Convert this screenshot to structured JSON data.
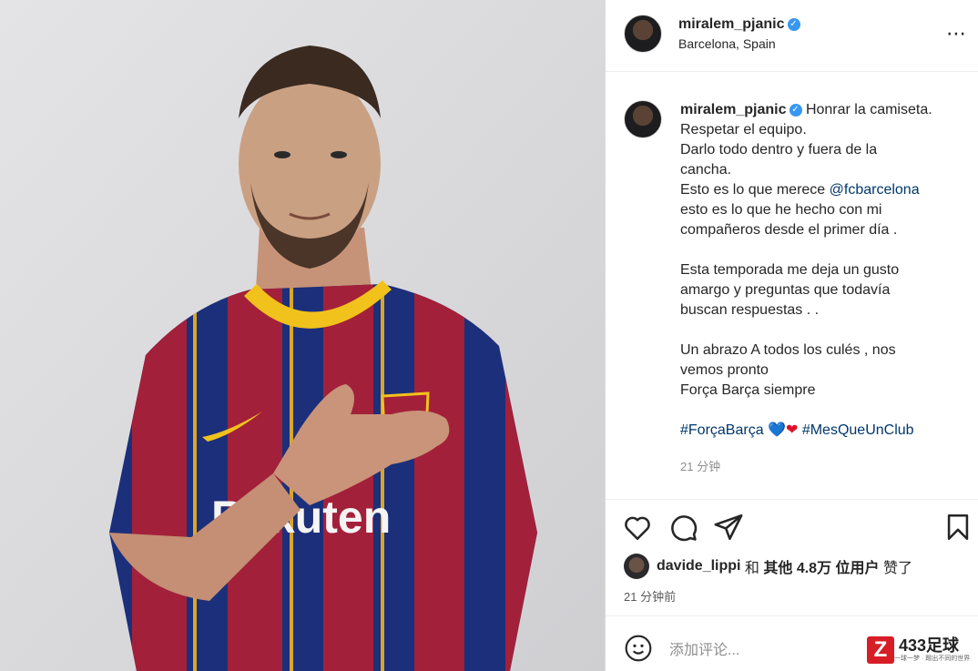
{
  "post": {
    "username": "miralem_pjanic",
    "location": "Barcelona, Spain",
    "more_icon": "⋯",
    "verified_icon": "✓"
  },
  "caption": {
    "username": "miralem_pjanic",
    "first_line": "Honrar la camiseta.",
    "lines": [
      "Respetar el equipo.",
      "Darlo todo dentro y fuera de la",
      "cancha.",
      "Esto es lo que merece ",
      "esto es lo que he hecho con mi",
      "compañeros desde el primer día .",
      "",
      "Esta temporada me deja un gusto",
      "amargo y preguntas que todavía",
      "buscan respuestas . .",
      "",
      "Un abrazo A todos los culés , nos",
      "vemos pronto",
      "Força Barça siempre",
      ""
    ],
    "mention": "@fcbarcelona",
    "hashtag1": "#ForçaBarça",
    "hashtag2": "#MesQueUnClub",
    "heart_blue": "💙",
    "heart_red": "❤",
    "time": "21 分钟"
  },
  "actions": {
    "like_icon": "heart-outline-icon",
    "comment_icon": "comment-bubble-icon",
    "share_icon": "paper-plane-icon",
    "save_icon": "bookmark-icon"
  },
  "likes": {
    "user": "davide_lippi",
    "and": " 和 ",
    "others": "其他 4.8万 位用户",
    "liked": " 赞了"
  },
  "post_time": "21 分钟前",
  "comment_box": {
    "placeholder": "添加评论..."
  },
  "watermark": {
    "logo": "Z",
    "name": "433足球",
    "slogan": "一球一梦 · 踢出不同的世界"
  },
  "colors": {
    "accent": "#3897f0",
    "link": "#00376b",
    "jersey_blue": "#1c2f7a",
    "jersey_red": "#a3203a",
    "collar": "#f1c21c"
  }
}
